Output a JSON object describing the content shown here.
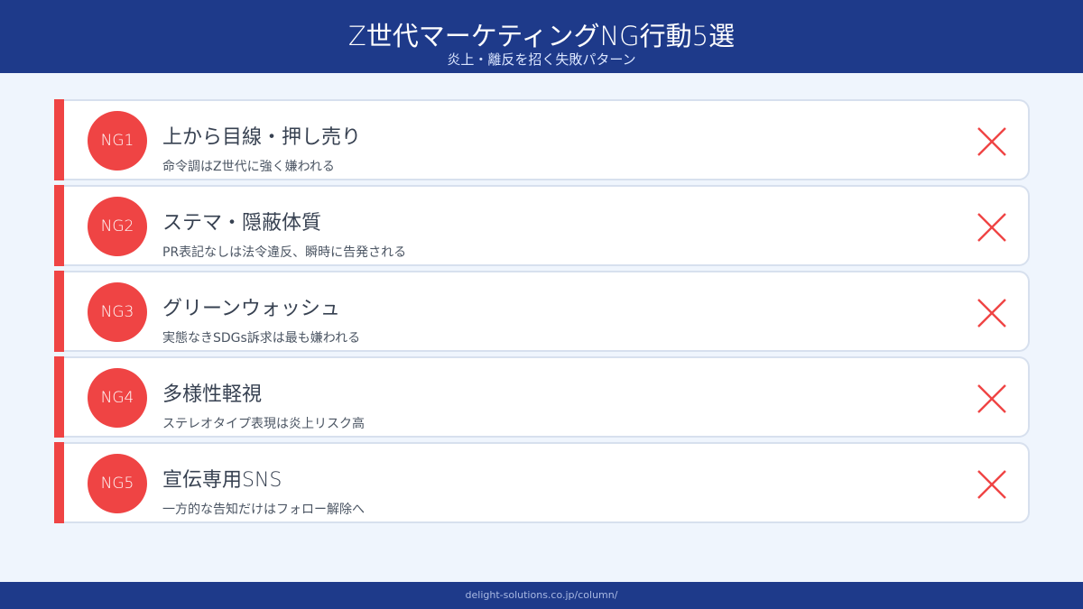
{
  "header": {
    "title": "Z世代マーケティングNG行動5選",
    "subtitle": "炎上・離反を招く失敗パターン"
  },
  "items": [
    {
      "badge": "NG1",
      "title": "上から目線・押し売り",
      "description": "命令調はZ世代に強く嫌われる"
    },
    {
      "badge": "NG2",
      "title": "ステマ・隠蔽体質",
      "description": "PR表記なしは法令違反、瞬時に告発される"
    },
    {
      "badge": "NG3",
      "title": "グリーンウォッシュ",
      "description": "実態なきSDGs訴求は最も嫌われる"
    },
    {
      "badge": "NG4",
      "title": "多様性軽視",
      "description": "ステレオタイプ表現は炎上リスク高"
    },
    {
      "badge": "NG5",
      "title": "宣伝専用SNS",
      "description": "一方的な告知だけはフォロー解除へ"
    }
  ],
  "footer": {
    "url": "delight-solutions.co.jp/column/"
  },
  "colors": {
    "accent": "#ef4444",
    "brand": "#1e3a8a",
    "background": "#eff5fd"
  },
  "icons": {
    "status": "x-mark-icon"
  }
}
